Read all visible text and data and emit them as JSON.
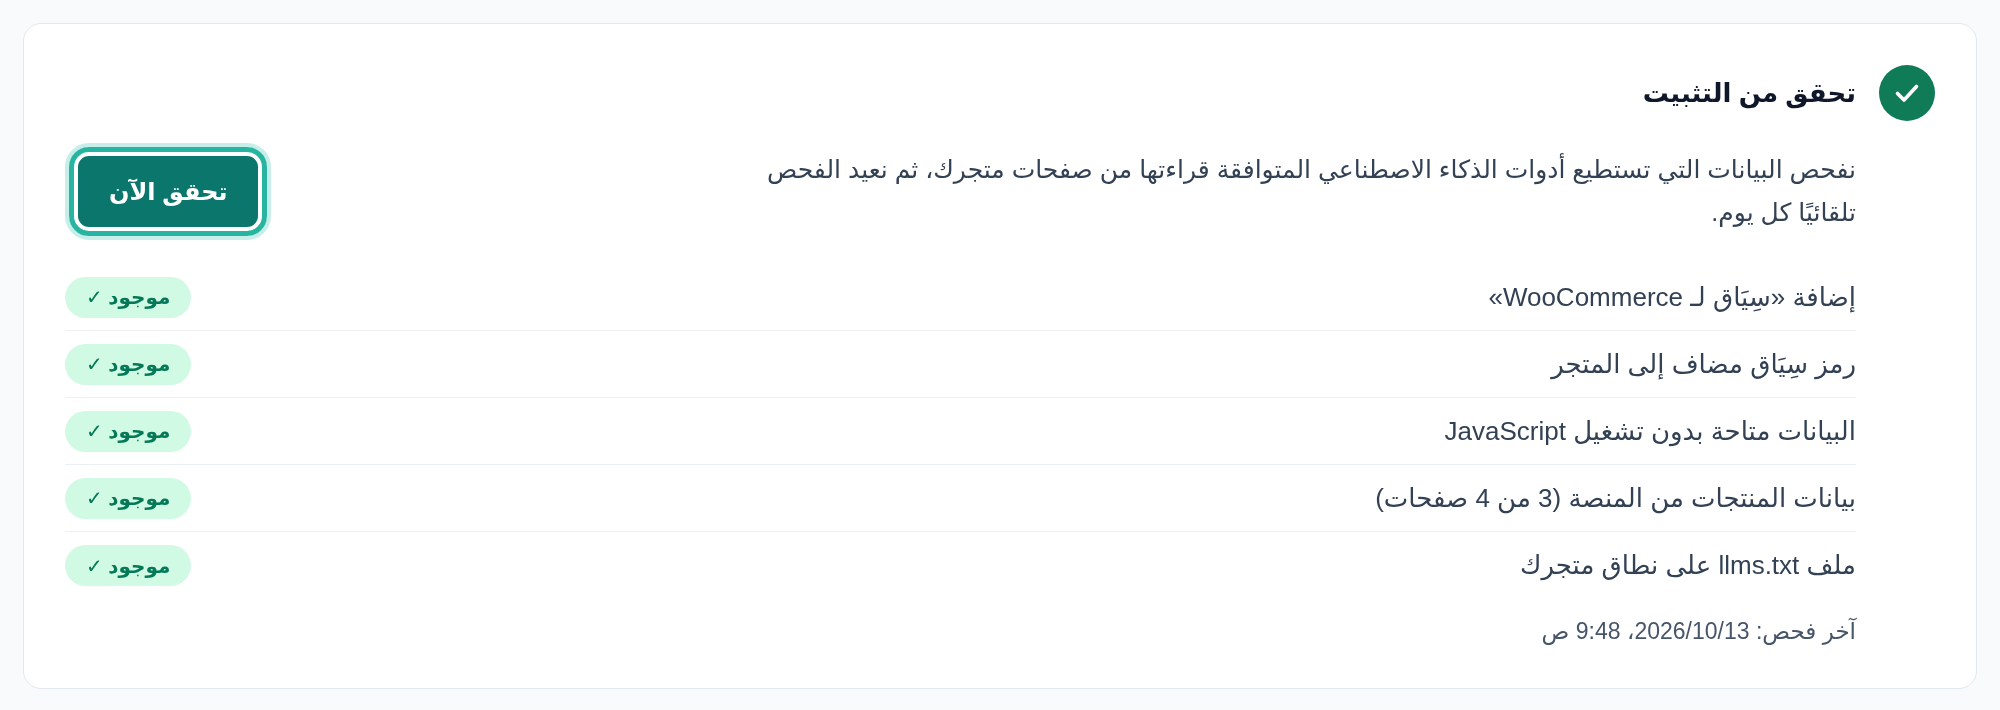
{
  "header": {
    "title": "تحقق من التثبيت",
    "verified": true
  },
  "description": "نفحص البيانات التي تستطيع أدوات الذكاء الاصطناعي المتوافقة قراءتها من صفحات متجرك، ثم نعيد الفحص تلقائيًا كل يوم.",
  "check_button": {
    "label": "تحقق الآن",
    "focused": true
  },
  "checks": [
    {
      "label": "إضافة «سِيَاق لـ WooCommerce»",
      "passed": true,
      "badge": "موجود ✓"
    },
    {
      "label": "رمز سِيَاق مضاف إلى المتجر",
      "passed": true,
      "badge": "موجود ✓"
    },
    {
      "label": "البيانات متاحة بدون تشغيل JavaScript",
      "passed": true,
      "badge": "موجود ✓"
    },
    {
      "label": "بيانات المنتجات من المنصة (3 من 4 صفحات)",
      "passed": true,
      "badge": "موجود ✓"
    },
    {
      "label": "ملف llms.txt على نطاق متجرك",
      "passed": true,
      "badge": "موجود ✓"
    }
  ],
  "last_checked": "آخر فحص: 2026/10/13، 9:48 ص"
}
